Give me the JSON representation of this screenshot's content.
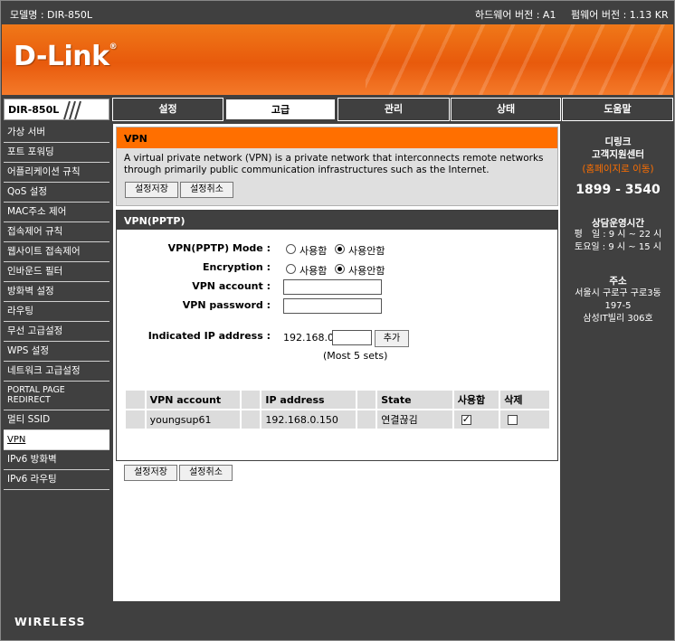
{
  "topbar": {
    "model": "모델명 : DIR-850L",
    "hw_version": "하드웨어 버전 : A1",
    "fw_version": "펌웨어 버전 : 1.13 KR"
  },
  "logo": {
    "text": "D-Link",
    "mark": "®"
  },
  "model_tag": "DIR-850L",
  "tabs": [
    {
      "label": "설정",
      "active": false
    },
    {
      "label": "고급",
      "active": true
    },
    {
      "label": "관리",
      "active": false
    },
    {
      "label": "상태",
      "active": false
    },
    {
      "label": "도움말",
      "active": false
    }
  ],
  "sidebar": {
    "items": [
      {
        "label": "가상 서버"
      },
      {
        "label": "포트 포워딩"
      },
      {
        "label": "어플리케이션 규칙"
      },
      {
        "label": "QoS 설정"
      },
      {
        "label": "MAC주소 제어"
      },
      {
        "label": "접속제어 규칙"
      },
      {
        "label": "웹사이트 접속제어"
      },
      {
        "label": "인바운드 필터"
      },
      {
        "label": "방화벽 설정"
      },
      {
        "label": "라우팅"
      },
      {
        "label": "무선 고급설정"
      },
      {
        "label": "WPS 설정"
      },
      {
        "label": "네트워크 고급설정"
      },
      {
        "label": "PORTAL PAGE REDIRECT"
      },
      {
        "label": "멀티 SSID"
      },
      {
        "label": "VPN"
      },
      {
        "label": "IPv6 방화벽"
      },
      {
        "label": "IPv6 라우팅"
      }
    ]
  },
  "vpn_info": {
    "title": "VPN",
    "description": "A virtual private network (VPN) is a private network that interconnects remote networks through primarily public communication infrastructures such as the Internet.",
    "save_label": "설정저장",
    "cancel_label": "설정취소"
  },
  "pptp": {
    "title": "VPN(PPTP)",
    "mode_label": "VPN(PPTP) Mode :",
    "encryption_label": "Encryption :",
    "enable_label": "사용함",
    "disable_label": "사용안함",
    "mode_value": "사용안함",
    "encryption_value": "사용안함",
    "account_label": "VPN account :",
    "account_value": "",
    "password_label": "VPN password :",
    "password_value": "",
    "ip_label": "Indicated IP address :",
    "ip_prefix": "192.168.0.",
    "ip_suffix_value": "",
    "add_label": "추가",
    "max_note": "(Most 5 sets)"
  },
  "table": {
    "headers": [
      "VPN account",
      "IP address",
      "State",
      "사용함",
      "삭제"
    ],
    "rows": [
      {
        "account": "youngsup61",
        "ip": "192.168.0.150",
        "state": "연결끊김",
        "enabled": true,
        "delete": false
      }
    ]
  },
  "bottom_buttons": {
    "save_label": "설정저장",
    "cancel_label": "설정취소"
  },
  "support": {
    "title_line1": "디링크",
    "title_line2": "고객지원센터",
    "homepage_link": "(홈페이지로 이동)",
    "phone": "1899 - 3540",
    "hours_title": "상담운영시간",
    "weekday": "평　일 : 9 시 ~ 22 시",
    "saturday": "토요일 : 9 시 ~ 15 시",
    "address_title": "주소",
    "address_line1": "서울시 구로구 구로3동",
    "address_line2": "197-5",
    "address_line3": "삼성IT빌리 306호"
  },
  "footer": {
    "text": "WIRELESS"
  },
  "colors": {
    "accent": "#ff6f00",
    "dark": "#404040",
    "link": "#ff6f00"
  }
}
